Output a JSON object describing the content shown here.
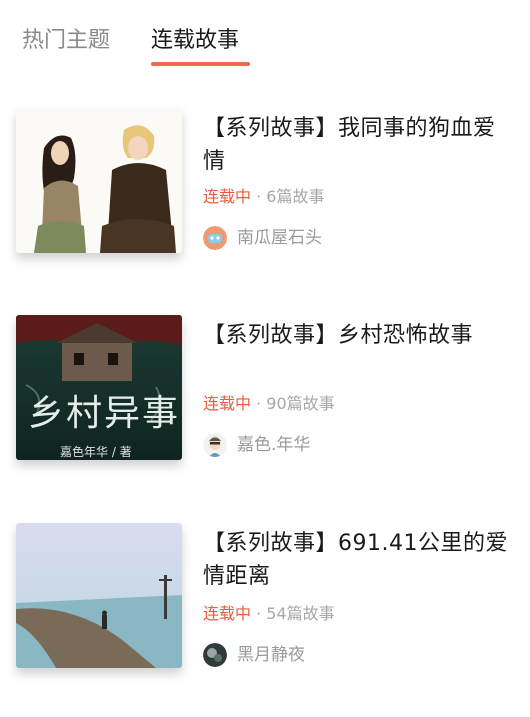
{
  "tabs": [
    {
      "label": "热门主题"
    },
    {
      "label": "连载故事"
    }
  ],
  "stories": [
    {
      "title": "【系列故事】我同事的狗血爱情",
      "status": "连载中",
      "count": "· 6篇故事",
      "author": "南瓜屋石头",
      "avatar_icon": "robot-avatar-icon"
    },
    {
      "title": "【系列故事】乡村恐怖故事",
      "status": "连载中",
      "count": "· 90篇故事",
      "author": "嘉色.年华",
      "avatar_icon": "cartoon-face-avatar-icon",
      "cover_text": "乡村异事",
      "cover_caption": "嘉色年华 / 著"
    },
    {
      "title": "【系列故事】691.41公里的爱情距离",
      "status": "连载中",
      "count": "· 54篇故事",
      "author": "黑月静夜",
      "avatar_icon": "photo-avatar-icon"
    }
  ],
  "colors": {
    "accent": "#ef6a4c",
    "status": "#ef5a3c",
    "muted": "#a8a8a8"
  }
}
